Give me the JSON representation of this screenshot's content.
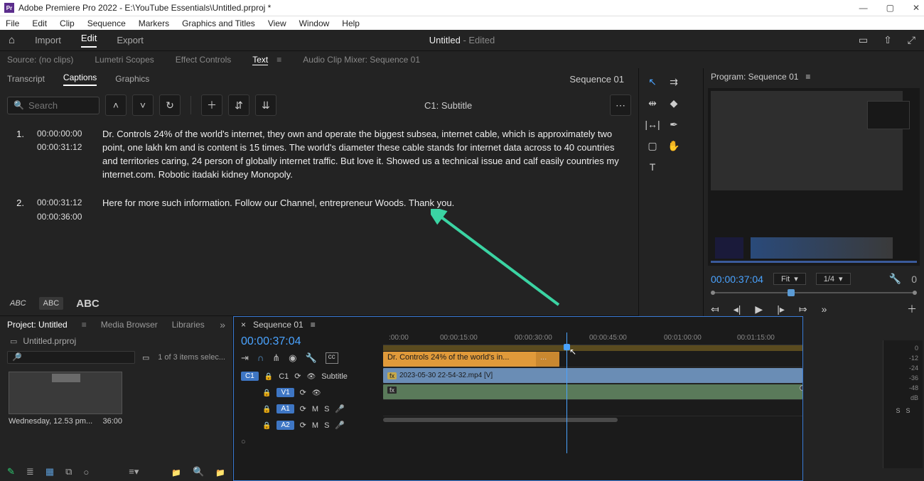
{
  "titlebar": {
    "app_icon": "Pr",
    "text": "Adobe Premiere Pro 2022 - E:\\YouTube Essentials\\Untitled.prproj *"
  },
  "win": {
    "min": "—",
    "max": "▢",
    "close": "✕"
  },
  "menubar": [
    "File",
    "Edit",
    "Clip",
    "Sequence",
    "Markers",
    "Graphics and Titles",
    "View",
    "Window",
    "Help"
  ],
  "workspace": {
    "tabs": [
      "Import",
      "Edit",
      "Export"
    ],
    "active": 1,
    "doc_title": "Untitled",
    "doc_suffix": "- Edited"
  },
  "mid_tabs": {
    "items": [
      "Source: (no clips)",
      "Lumetri Scopes",
      "Effect Controls",
      "Text",
      "Audio Clip Mixer: Sequence 01"
    ],
    "active": 3
  },
  "caption_panel": {
    "sub_tabs": [
      "Transcript",
      "Captions",
      "Graphics"
    ],
    "sub_active": 1,
    "sequence_label": "Sequence 01",
    "search_placeholder": "Search",
    "track_label": "C1: Subtitle",
    "footer_opts": [
      "ABC",
      "ABC",
      "ABC"
    ],
    "rows": [
      {
        "idx": "1.",
        "in": "00:00:00:00",
        "out": "00:00:31:12",
        "text": "Dr. Controls 24% of the world's internet, they own and operate the biggest subsea, internet cable, which is approximately two point, one lakh km and is content is 15 times. The world's diameter these cable stands for internet data across to 40 countries and territories caring, 24 person of globally internet traffic. But love it. Showed us a technical issue and calf easily countries my internet.com. Robotic itadaki kidney Monopoly."
      },
      {
        "idx": "2.",
        "in": "00:00:31:12",
        "out": "00:00:36:00",
        "text": "Here for more such information. Follow our Channel, entrepreneur Woods. Thank you."
      }
    ]
  },
  "program": {
    "tab": "Program: Sequence 01",
    "timecode": "00:00:37:04",
    "fit": "Fit",
    "scale": "1/4",
    "zero": "0"
  },
  "project": {
    "tabs": [
      "Project: Untitled",
      "Media Browser",
      "Libraries"
    ],
    "file": "Untitled.prproj",
    "items_count": "1 of 3 items selec...",
    "thumb_label": "Wednesday, 12.53 pm...",
    "thumb_dur": "36:00"
  },
  "timeline": {
    "tab": "Sequence 01",
    "timecode": "00:00:37:04",
    "ruler": [
      ":00:00",
      "00:00:15:00",
      "00:00:30:00",
      "00:00:45:00",
      "00:01:00:00",
      "00:01:15:00"
    ],
    "caption_clip": "Dr. Controls 24% of the world's in...",
    "caption_clip2": "...",
    "subtitle_track_label": "Subtitle",
    "video_clip": "2023-05-30 22-54-32.mp4 [V]",
    "v1": "V1",
    "a1": "A1",
    "a2": "A2",
    "c1": "C1",
    "c1b": "C1",
    "m": "M",
    "s": "S"
  },
  "meter": {
    "scale": [
      "0",
      "-12",
      "-24",
      "-36",
      "-48",
      "dB"
    ],
    "ch": [
      "S",
      "S"
    ]
  }
}
